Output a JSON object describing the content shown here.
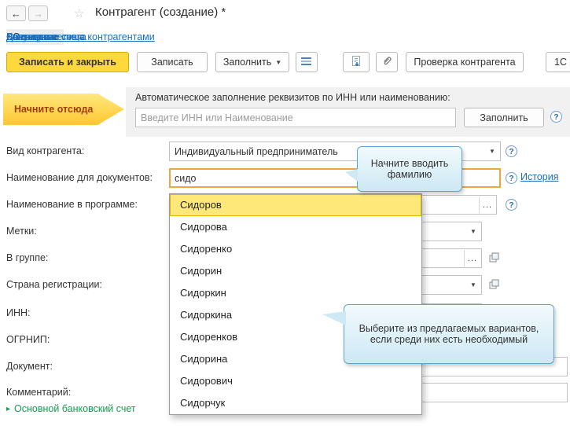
{
  "header": {
    "title": "Контрагент (создание) *"
  },
  "icons": {
    "back": "←",
    "forward": "→",
    "star": "☆",
    "caret": "▼",
    "expand": "▸",
    "list_lines_icon": "blue-horizontal-lines",
    "document_arrow_icon": "document-with-blue-arrow",
    "paperclip_icon": "paperclip",
    "open_icon": "two-overlapping-squares"
  },
  "tabs": [
    {
      "label": "Основное"
    },
    {
      "label": "Документы"
    },
    {
      "label": "Договоры"
    },
    {
      "label": "Банковские счета"
    },
    {
      "label": "Контактные лица"
    },
    {
      "label": "Счета расчетов с контрагентами"
    }
  ],
  "toolbar": {
    "save_close": "Записать и закрыть",
    "save": "Записать",
    "fill": "Заполнить",
    "check": "Проверка контрагента",
    "partner": "1С"
  },
  "autofill": {
    "arrow_label": "Начните отсюда",
    "caption": "Автоматическое заполнение реквизитов по ИНН или наименованию:",
    "placeholder": "Введите ИНН или Наименование",
    "fill_button": "Заполнить",
    "help": "?"
  },
  "form": {
    "kind_label": "Вид контрагента:",
    "kind_value": "Индивидуальный предприниматель",
    "doc_name_label": "Наименование для документов:",
    "doc_name_value": "сидо",
    "history_link": "История",
    "prog_name_label": "Наименование в программе:",
    "tags_label": "Метки:",
    "group_label": "В группе:",
    "country_label": "Страна регистрации:",
    "inn_label": "ИНН:",
    "ogrnip_label": "ОГРНИП:",
    "document_label": "Документ:",
    "comment_label": "Комментарий:",
    "help": "?",
    "ellipsis": "...",
    "bank_link": "Основной банковский счет"
  },
  "dropdown": {
    "items": [
      "Сидоров",
      "Сидорова",
      "Сидоренко",
      "Сидорин",
      "Сидоркин",
      "Сидоркина",
      "Сидоренков",
      "Сидорина",
      "Сидорович",
      "Сидорчук"
    ],
    "selected_index": 0
  },
  "callouts": {
    "hint1": "Начните вводить фамилию",
    "hint2": "Выберите из предлагаемых вариантов, если среди них есть необходимый"
  },
  "colors": {
    "primary_button": "#ffd93b",
    "link": "#1b6fbe",
    "green_link": "#169c4f",
    "highlight_row": "#ffe87a",
    "input_highlight_border": "#eda73c",
    "callout_border": "#5aa7c6",
    "arrow_callout": "#ffc62f"
  }
}
